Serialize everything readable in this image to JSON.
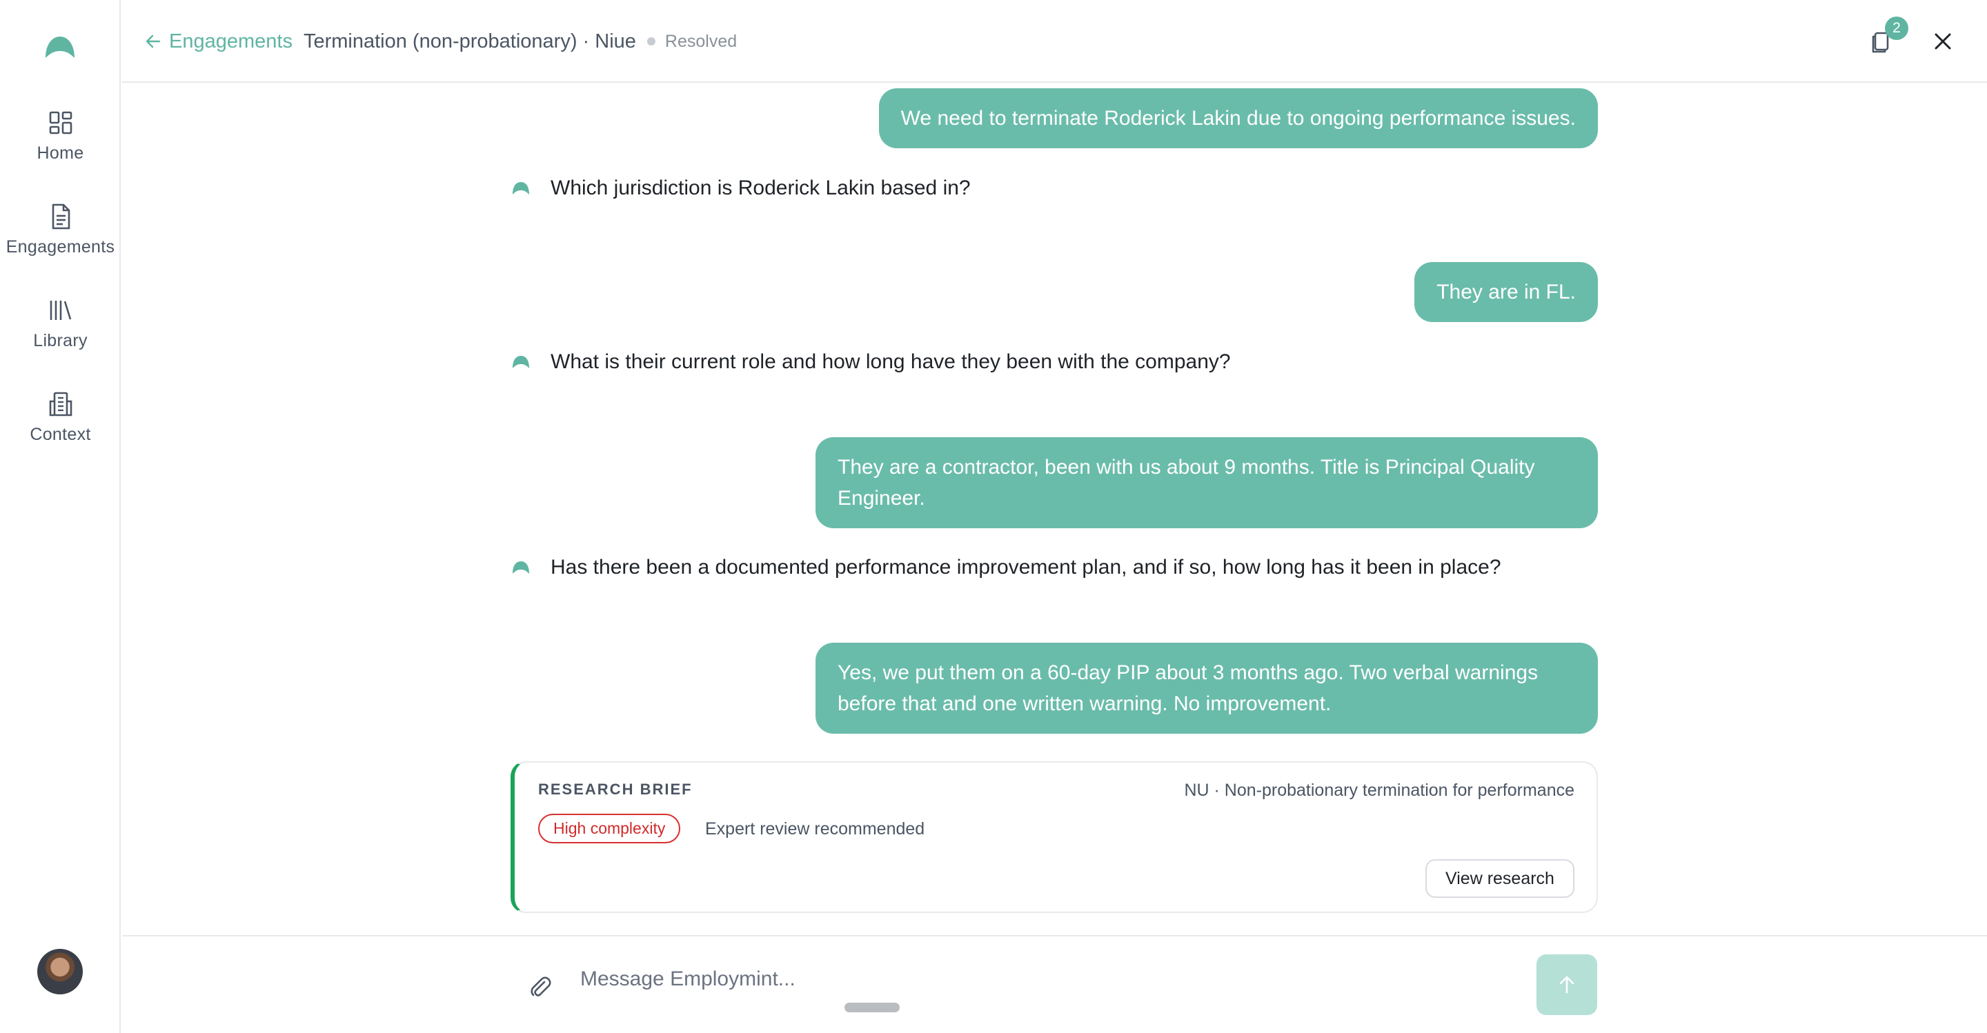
{
  "sidebar": {
    "items": [
      {
        "label": "Home",
        "icon": "grid-icon"
      },
      {
        "label": "Engagements",
        "icon": "document-icon"
      },
      {
        "label": "Library",
        "icon": "library-icon"
      },
      {
        "label": "Context",
        "icon": "building-icon"
      }
    ]
  },
  "header": {
    "back_label": "Engagements",
    "title": "Termination (non-probationary) · Niue",
    "status": "Resolved",
    "documents_badge": "2"
  },
  "conversation": {
    "messages": [
      {
        "role": "user",
        "text": "We need to terminate Roderick Lakin due to ongoing performance issues."
      },
      {
        "role": "assistant",
        "text": "Which jurisdiction is Roderick Lakin based in?"
      },
      {
        "role": "user",
        "text": "They are in FL."
      },
      {
        "role": "assistant",
        "text": "What is their current role and how long have they been with the company?"
      },
      {
        "role": "user",
        "text": "They are a contractor, been with us about 9 months. Title is Principal Quality Engineer."
      },
      {
        "role": "assistant",
        "text": "Has there been a documented performance improvement plan, and if so, how long has it been in place?"
      },
      {
        "role": "user",
        "text": "Yes, we put them on a 60-day PIP about 3 months ago. Two verbal warnings before that and one written warning. No improvement."
      }
    ]
  },
  "research_brief": {
    "title": "RESEARCH BRIEF",
    "meta": "NU · Non-probationary termination for performance",
    "complexity": "High complexity",
    "note": "Expert review recommended",
    "button_label": "View research"
  },
  "composer": {
    "placeholder": "Message Employmint..."
  },
  "colors": {
    "accent": "#5fb5a2",
    "user_bubble": "#6abcaa",
    "send_disabled": "#b5e0d6",
    "complexity_red": "#d02a2a",
    "brief_border": "#1aa35a"
  }
}
